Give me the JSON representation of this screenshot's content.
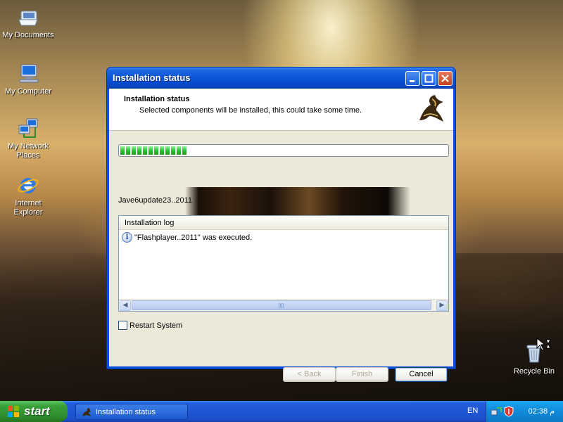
{
  "desktop": {
    "icons": [
      {
        "label": "My Documents"
      },
      {
        "label": "My Computer"
      },
      {
        "label": "My Network Places"
      },
      {
        "label": "Internet Explorer"
      }
    ],
    "recycle_bin": "Recycle Bin"
  },
  "window": {
    "title": "Installation status",
    "header": {
      "title": "Installation status",
      "subtitle": "Selected components will be installed, this could take some time."
    },
    "progress": {
      "percent": 17,
      "blocks": 12
    },
    "current_file": "Jave6update23..2011",
    "log": {
      "header": "Installation log",
      "entries": [
        "\"Flashplayer..2011\" was executed."
      ]
    },
    "restart_label": "Restart System",
    "restart_checked": false,
    "buttons": {
      "back": "< Back",
      "finish": "Finish",
      "cancel": "Cancel"
    }
  },
  "taskbar": {
    "start_label": "start",
    "task_label": "Installation status",
    "language": "EN",
    "clock": "02:38 م"
  },
  "colors": {
    "titlebar": "#0a55d8",
    "taskbar": "#245edb",
    "start": "#389f38",
    "progress": "#2fc12f"
  }
}
